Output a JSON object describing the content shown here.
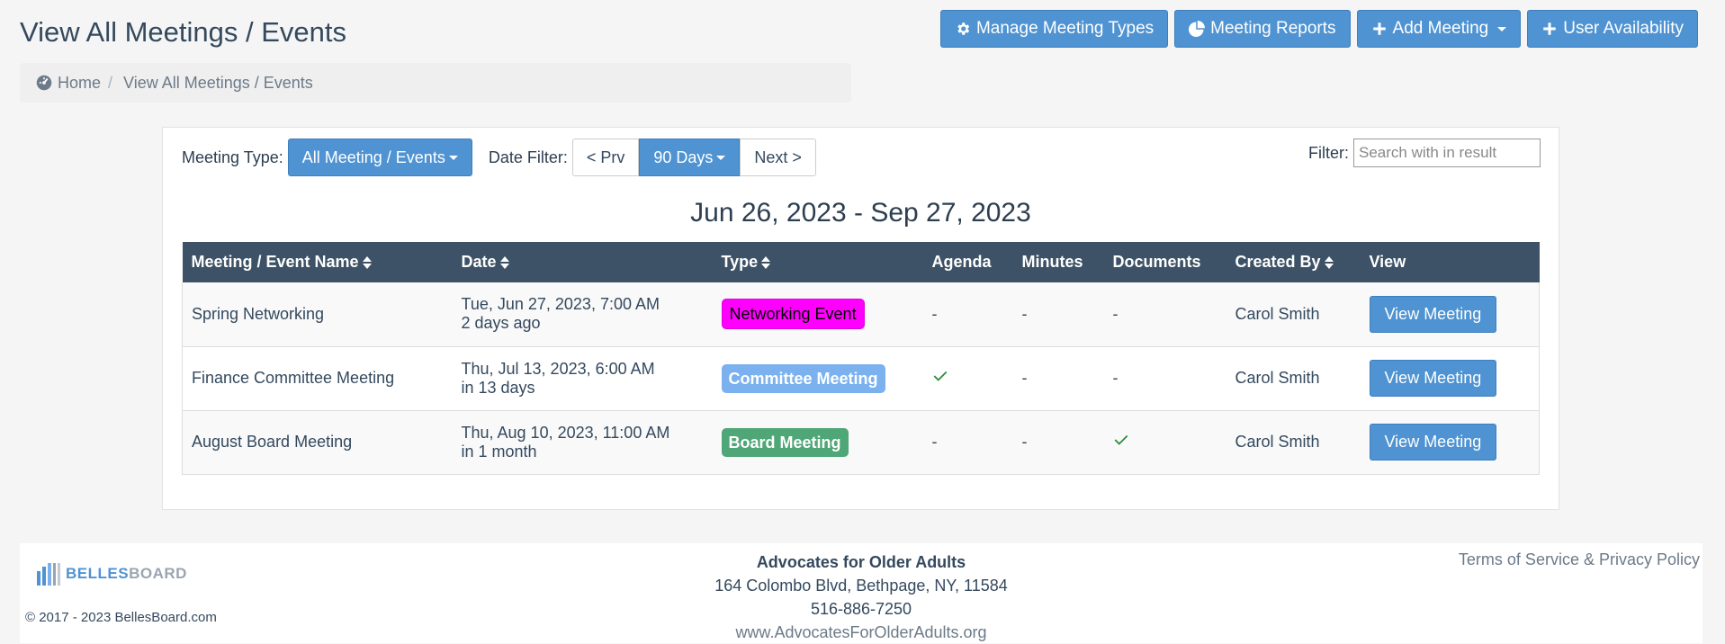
{
  "page": {
    "title": "View All Meetings / Events"
  },
  "actions": {
    "manage_types": "Manage Meeting Types",
    "reports": "Meeting Reports",
    "add_meeting": "Add Meeting",
    "user_availability": "User Availability"
  },
  "breadcrumb": {
    "home": "Home",
    "current": "View All Meetings / Events"
  },
  "filters": {
    "meeting_type_label": "Meeting Type:",
    "meeting_type_value": "All Meeting / Events",
    "date_filter_label": "Date Filter:",
    "prev": "< Prv",
    "range": "90 Days",
    "next": "Next >",
    "search_label": "Filter:",
    "search_placeholder": "Search with in result"
  },
  "range_title": "Jun 26, 2023 - Sep 27, 2023",
  "table": {
    "headers": [
      "Meeting / Event Name",
      "Date",
      "Type",
      "Agenda",
      "Minutes",
      "Documents",
      "Created By",
      "View"
    ],
    "rows": [
      {
        "name": "Spring Networking",
        "date": "Tue, Jun 27, 2023, 7:00 AM",
        "relative": "2 days ago",
        "type": "Networking Event",
        "agenda": "-",
        "minutes": "-",
        "documents": "-",
        "created_by": "Carol Smith",
        "view": "View Meeting"
      },
      {
        "name": "Finance Committee Meeting",
        "date": "Thu, Jul 13, 2023, 6:00 AM",
        "relative": "in 13 days",
        "type": "Committee Meeting",
        "agenda": "check",
        "minutes": "-",
        "documents": "-",
        "created_by": "Carol Smith",
        "view": "View Meeting"
      },
      {
        "name": "August Board Meeting",
        "date": "Thu, Aug 10, 2023, 11:00 AM",
        "relative": "in 1 month",
        "type": "Board Meeting",
        "agenda": "-",
        "minutes": "-",
        "documents": "check",
        "created_by": "Carol Smith",
        "view": "View Meeting"
      }
    ]
  },
  "footer": {
    "logo_part1": "BELLES",
    "logo_part2": "BOARD",
    "copyright": "© 2017 - 2023 BellesBoard.com",
    "org_name": "Advocates for Older Adults",
    "address": "164 Colombo Blvd, Bethpage, NY, 11584",
    "phone": "516-886-7250",
    "website": "www.AdvocatesForOlderAdults.org",
    "terms": "Terms of Service & Privacy Policy"
  },
  "colors": {
    "primary": "#4f93d2",
    "header": "#3d5266",
    "networking": "#ff00ff",
    "committee": "#7bb1ef",
    "board": "#4fa677"
  }
}
